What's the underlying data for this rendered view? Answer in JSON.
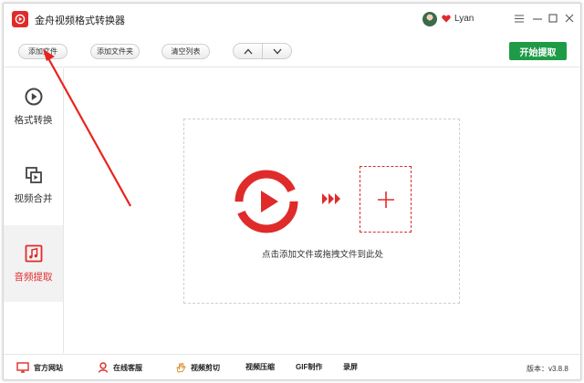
{
  "app": {
    "title": "金舟视频格式转换器"
  },
  "user": {
    "name": "Lyan"
  },
  "toolbar": {
    "add_file": "添加文件",
    "add_folder": "添加文件夹",
    "clear_list": "清空列表",
    "start": "开始提取"
  },
  "sidebar": {
    "items": [
      {
        "label": "格式转换",
        "icon": "play-circle-icon",
        "active": false
      },
      {
        "label": "视频合并",
        "icon": "merge-icon",
        "active": false
      },
      {
        "label": "音频提取",
        "icon": "music-note-icon",
        "active": true
      }
    ]
  },
  "main": {
    "hint": "点击添加文件或拖拽文件到此处"
  },
  "footer": {
    "official_site": "官方网站",
    "online_support": "在线客服",
    "video_cut": "视频剪切",
    "video_compress": "视频压缩",
    "gif_make": "GIF制作",
    "screen_record": "录屏",
    "version": "版本：v3.8.8"
  },
  "colors": {
    "accent": "#e02b2b",
    "start_button": "#1f9b48"
  }
}
